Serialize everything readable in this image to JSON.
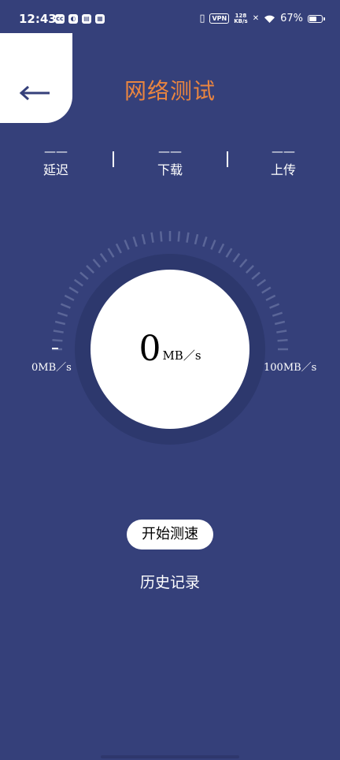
{
  "status_bar": {
    "time": "12:43",
    "left_icons": [
      "app-icon-1",
      "app-icon-2",
      "app-icon-3",
      "app-icon-4"
    ],
    "vpn_label": "VPN",
    "net_speed_value": "128",
    "net_speed_unit": "KB/s",
    "battery_percent": "67%",
    "battery_level": 0.67
  },
  "header": {
    "title": "网络测试",
    "title_color": "#e98540",
    "back_icon": "arrow-left-icon"
  },
  "stats": [
    {
      "label": "延迟",
      "value": "——"
    },
    {
      "label": "下载",
      "value": "——"
    },
    {
      "label": "上传",
      "value": "——"
    }
  ],
  "gauge": {
    "value": "0",
    "unit": "MB／s",
    "min_label": "0MB／s",
    "max_label": "100MB／s",
    "current_fraction": 0
  },
  "actions": {
    "start_label": "开始测速",
    "history_label": "历史记录"
  },
  "colors": {
    "background": "#35407a",
    "gauge_ring": "#2d386d",
    "tick": "#5b6698"
  }
}
